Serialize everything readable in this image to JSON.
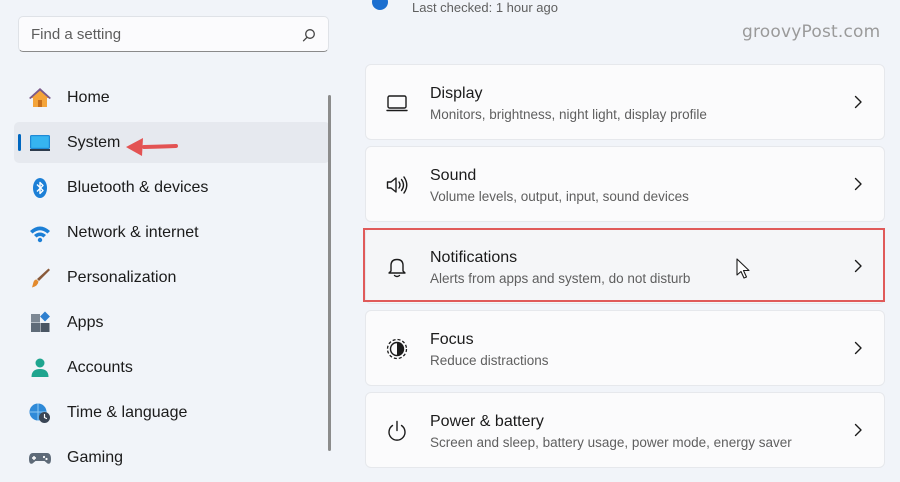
{
  "search": {
    "placeholder": "Find a setting"
  },
  "status": {
    "text": "Last checked: 1 hour ago"
  },
  "watermark": "groovyPost.com",
  "nav": [
    {
      "label": "Home",
      "icon": "home-icon",
      "selected": false
    },
    {
      "label": "System",
      "icon": "system-monitor-icon",
      "selected": true
    },
    {
      "label": "Bluetooth & devices",
      "icon": "bluetooth-icon",
      "selected": false
    },
    {
      "label": "Network & internet",
      "icon": "wifi-icon",
      "selected": false
    },
    {
      "label": "Personalization",
      "icon": "brush-icon",
      "selected": false
    },
    {
      "label": "Apps",
      "icon": "apps-icon",
      "selected": false
    },
    {
      "label": "Accounts",
      "icon": "person-icon",
      "selected": false
    },
    {
      "label": "Time & language",
      "icon": "globe-clock-icon",
      "selected": false
    },
    {
      "label": "Gaming",
      "icon": "gamepad-icon",
      "selected": false
    }
  ],
  "cards": [
    {
      "title": "Display",
      "subtitle": "Monitors, brightness, night light, display profile",
      "icon": "display-icon"
    },
    {
      "title": "Sound",
      "subtitle": "Volume levels, output, input, sound devices",
      "icon": "speaker-icon"
    },
    {
      "title": "Notifications",
      "subtitle": "Alerts from apps and system, do not disturb",
      "icon": "bell-icon",
      "highlighted": true
    },
    {
      "title": "Focus",
      "subtitle": "Reduce distractions",
      "icon": "focus-icon"
    },
    {
      "title": "Power & battery",
      "subtitle": "Screen and sleep, battery usage, power mode, energy saver",
      "icon": "power-icon"
    }
  ],
  "colors": {
    "accent": "#0067c0",
    "highlight": "#e05a5a",
    "background": "#f1f4f9"
  }
}
